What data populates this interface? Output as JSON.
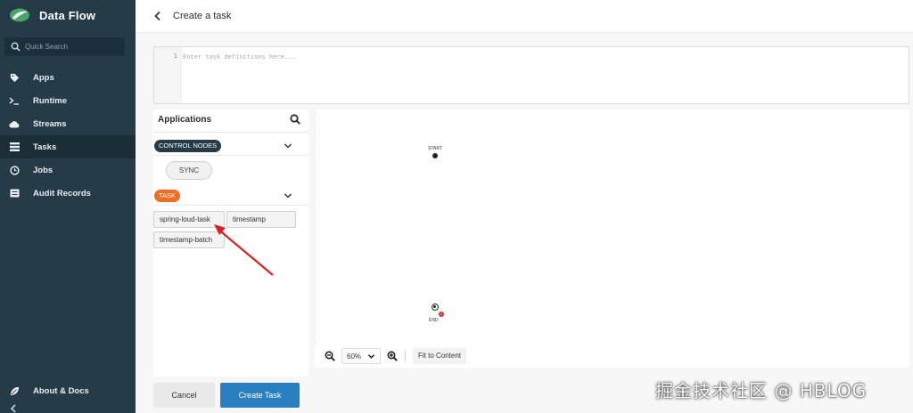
{
  "sidebar": {
    "brand": "Data Flow",
    "search_placeholder": "Quick Search",
    "items": [
      {
        "label": "Apps",
        "icon": "tag-icon"
      },
      {
        "label": "Runtime",
        "icon": "terminal-icon"
      },
      {
        "label": "Streams",
        "icon": "cloud-icon"
      },
      {
        "label": "Tasks",
        "icon": "list-icon",
        "active": true
      },
      {
        "label": "Jobs",
        "icon": "clock-icon"
      },
      {
        "label": "Audit Records",
        "icon": "record-icon"
      }
    ],
    "bottom_item": {
      "label": "About & Docs",
      "icon": "leaf-icon"
    }
  },
  "header": {
    "title": "Create a task"
  },
  "editor": {
    "line_number": "1",
    "placeholder": "Enter task definitions here..."
  },
  "palette": {
    "title": "Applications",
    "groups": [
      {
        "label": "CONTROL NODES",
        "items": [
          "SYNC"
        ]
      },
      {
        "label": "TASK",
        "items": [
          "spring-loud-task",
          "timestamp",
          "timestamp-batch"
        ]
      }
    ]
  },
  "canvas": {
    "start_label": "START",
    "end_label": "END",
    "end_error_count": "1",
    "zoom": "60%",
    "fit_label": "Fit to Content"
  },
  "footer": {
    "cancel_label": "Cancel",
    "create_label": "Create Task"
  },
  "watermark": "掘金技术社区 @ HBLOG",
  "colors": {
    "sidebar": "#253b47",
    "primary": "#2a7fc1",
    "task_badge": "#f36c21",
    "annotation_arrow": "#e02020"
  }
}
